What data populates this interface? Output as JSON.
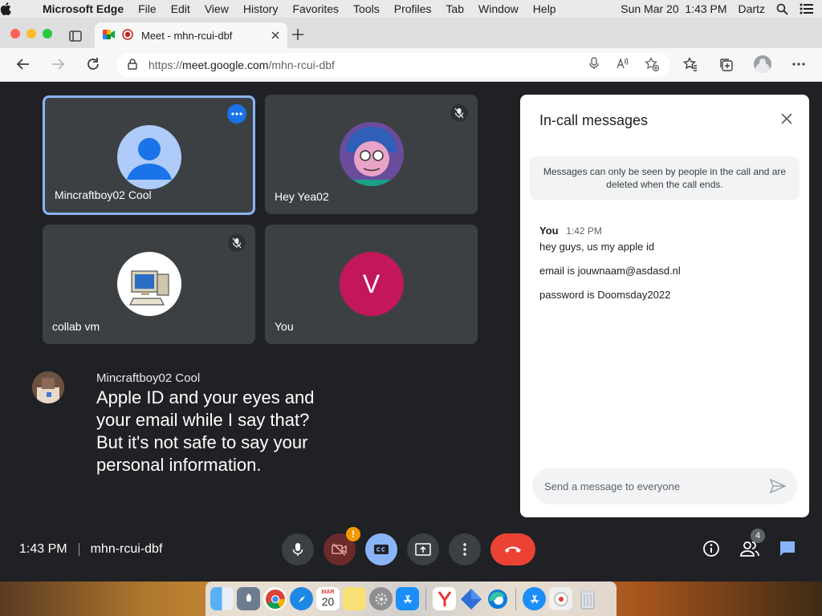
{
  "menubar": {
    "app_name": "Microsoft Edge",
    "menus": [
      "File",
      "Edit",
      "View",
      "History",
      "Favorites",
      "Tools",
      "Profiles",
      "Tab",
      "Window",
      "Help"
    ],
    "datetime": "Sun Mar 20  1:43 PM",
    "user": "Dartz"
  },
  "browser": {
    "tab_title": "Meet - mhn-rcui-dbf",
    "url_prefix": "https://",
    "url_host": "meet.google.com",
    "url_path": "/mhn-rcui-dbf"
  },
  "tiles": [
    {
      "name": "Mincraftboy02 Cool",
      "active": true
    },
    {
      "name": "Hey Yea02",
      "muted": true
    },
    {
      "name": "collab vm",
      "muted": true
    },
    {
      "name": "You",
      "avatar_letter": "V"
    }
  ],
  "caption": {
    "speaker": "Mincraftboy02 Cool",
    "text": "Apple ID and your eyes and your email while I say that? But it's not safe to say your personal information."
  },
  "chat": {
    "title": "In-call messages",
    "notice": "Messages can only be seen by people in the call and are deleted when the call ends.",
    "messages": [
      {
        "sender": "You",
        "time": "1:42 PM",
        "lines": [
          "hey guys, us my apple id",
          "email is jouwnaam@asdasd.nl",
          "password is Doomsday2022"
        ]
      }
    ],
    "compose_placeholder": "Send a message to everyone"
  },
  "bottom": {
    "time": "1:43 PM",
    "meeting_code": "mhn-rcui-dbf",
    "camera_warning": "!",
    "people_count": "4"
  },
  "dock": {
    "calendar_month": "MAR",
    "calendar_day": "20"
  },
  "colors": {
    "meet_bg": "#202124",
    "tile_bg": "#3c4043",
    "active_border": "#8ab4f8",
    "end_call": "#ea4335",
    "you_avatar": "#c2185b"
  }
}
